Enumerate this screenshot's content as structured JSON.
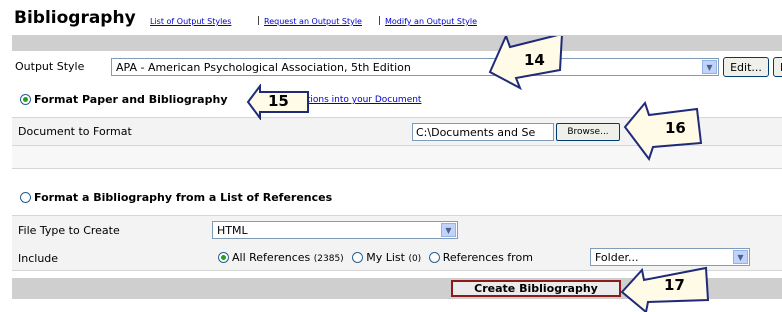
{
  "header": {
    "title": "Bibliography",
    "links": [
      "List of Output Styles",
      "Request an Output Style",
      "Modify an Output Style"
    ],
    "separator": "|"
  },
  "output_style": {
    "label": "Output Style",
    "selected": "APA - American Psychological Association, 5th Edition",
    "edit_label": "Edit...",
    "new_label": "Ne"
  },
  "format_paper": {
    "radio_label": "Format Paper and Bibliography",
    "link_label": "Enter Citations into your Document",
    "doc_label": "Document to Format",
    "doc_value": "C:\\Documents and Se",
    "browse_label": "Browse..."
  },
  "format_list": {
    "radio_label": "Format a Bibliography from a List of References",
    "file_type_label": "File Type to Create",
    "file_type_value": "HTML",
    "include_label": "Include",
    "all_refs_label": "All References",
    "all_refs_count": "(2385)",
    "my_list_label": "My List",
    "my_list_count": "(0)",
    "refs_from_label": "References from",
    "folder_value": "Folder..."
  },
  "create_label": "Create Bibliography",
  "callouts": [
    "14",
    "15",
    "16",
    "17"
  ],
  "colors": {
    "link": "#0000cc",
    "arrow_fill": "#fffbe6",
    "arrow_stroke": "#1f2a7a"
  }
}
